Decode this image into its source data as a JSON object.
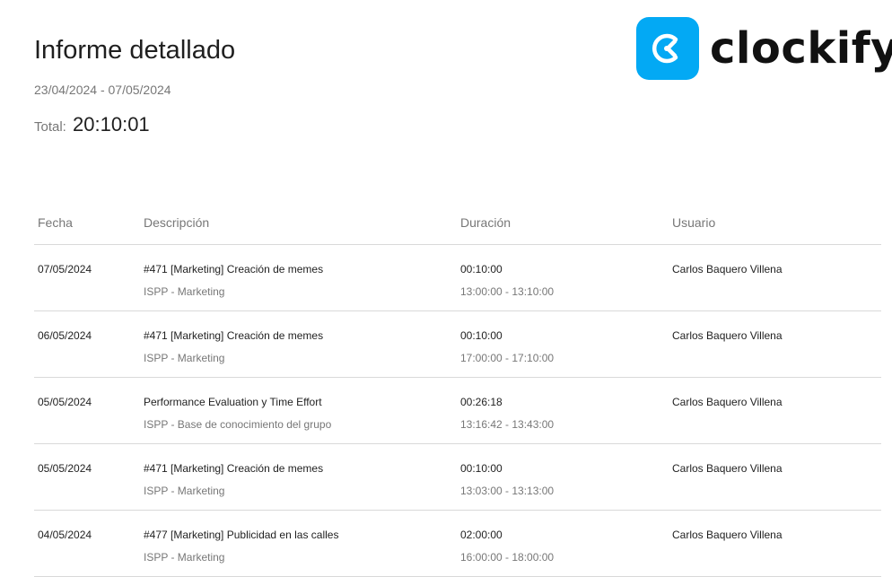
{
  "report": {
    "title": "Informe detallado",
    "date_range": "23/04/2024 - 07/05/2024",
    "total_label": "Total:",
    "total_value": "20:10:01"
  },
  "logo": {
    "text": "clockify",
    "icon": "clockify-logo-icon",
    "brand_color": "#03A9F4"
  },
  "table": {
    "headers": {
      "fecha": "Fecha",
      "descripcion": "Descripción",
      "duracion": "Duración",
      "usuario": "Usuario"
    },
    "rows": [
      {
        "fecha": "07/05/2024",
        "descripcion": "#471 [Marketing] Creación de memes",
        "proyecto": "ISPP - Marketing",
        "duracion": "00:10:00",
        "intervalo": "13:00:00 - 13:10:00",
        "usuario": "Carlos Baquero Villena"
      },
      {
        "fecha": "06/05/2024",
        "descripcion": "#471 [Marketing] Creación de memes",
        "proyecto": "ISPP - Marketing",
        "duracion": "00:10:00",
        "intervalo": "17:00:00 - 17:10:00",
        "usuario": "Carlos Baquero Villena"
      },
      {
        "fecha": "05/05/2024",
        "descripcion": "Performance Evaluation y Time Effort",
        "proyecto": "ISPP - Base de conocimiento del grupo",
        "duracion": "00:26:18",
        "intervalo": "13:16:42 - 13:43:00",
        "usuario": "Carlos Baquero Villena"
      },
      {
        "fecha": "05/05/2024",
        "descripcion": "#471 [Marketing] Creación de memes",
        "proyecto": "ISPP - Marketing",
        "duracion": "00:10:00",
        "intervalo": "13:03:00 - 13:13:00",
        "usuario": "Carlos Baquero Villena"
      },
      {
        "fecha": "04/05/2024",
        "descripcion": "#477 [Marketing] Publicidad en las calles",
        "proyecto": "ISPP - Marketing",
        "duracion": "02:00:00",
        "intervalo": "16:00:00 - 18:00:00",
        "usuario": "Carlos Baquero Villena"
      }
    ]
  }
}
